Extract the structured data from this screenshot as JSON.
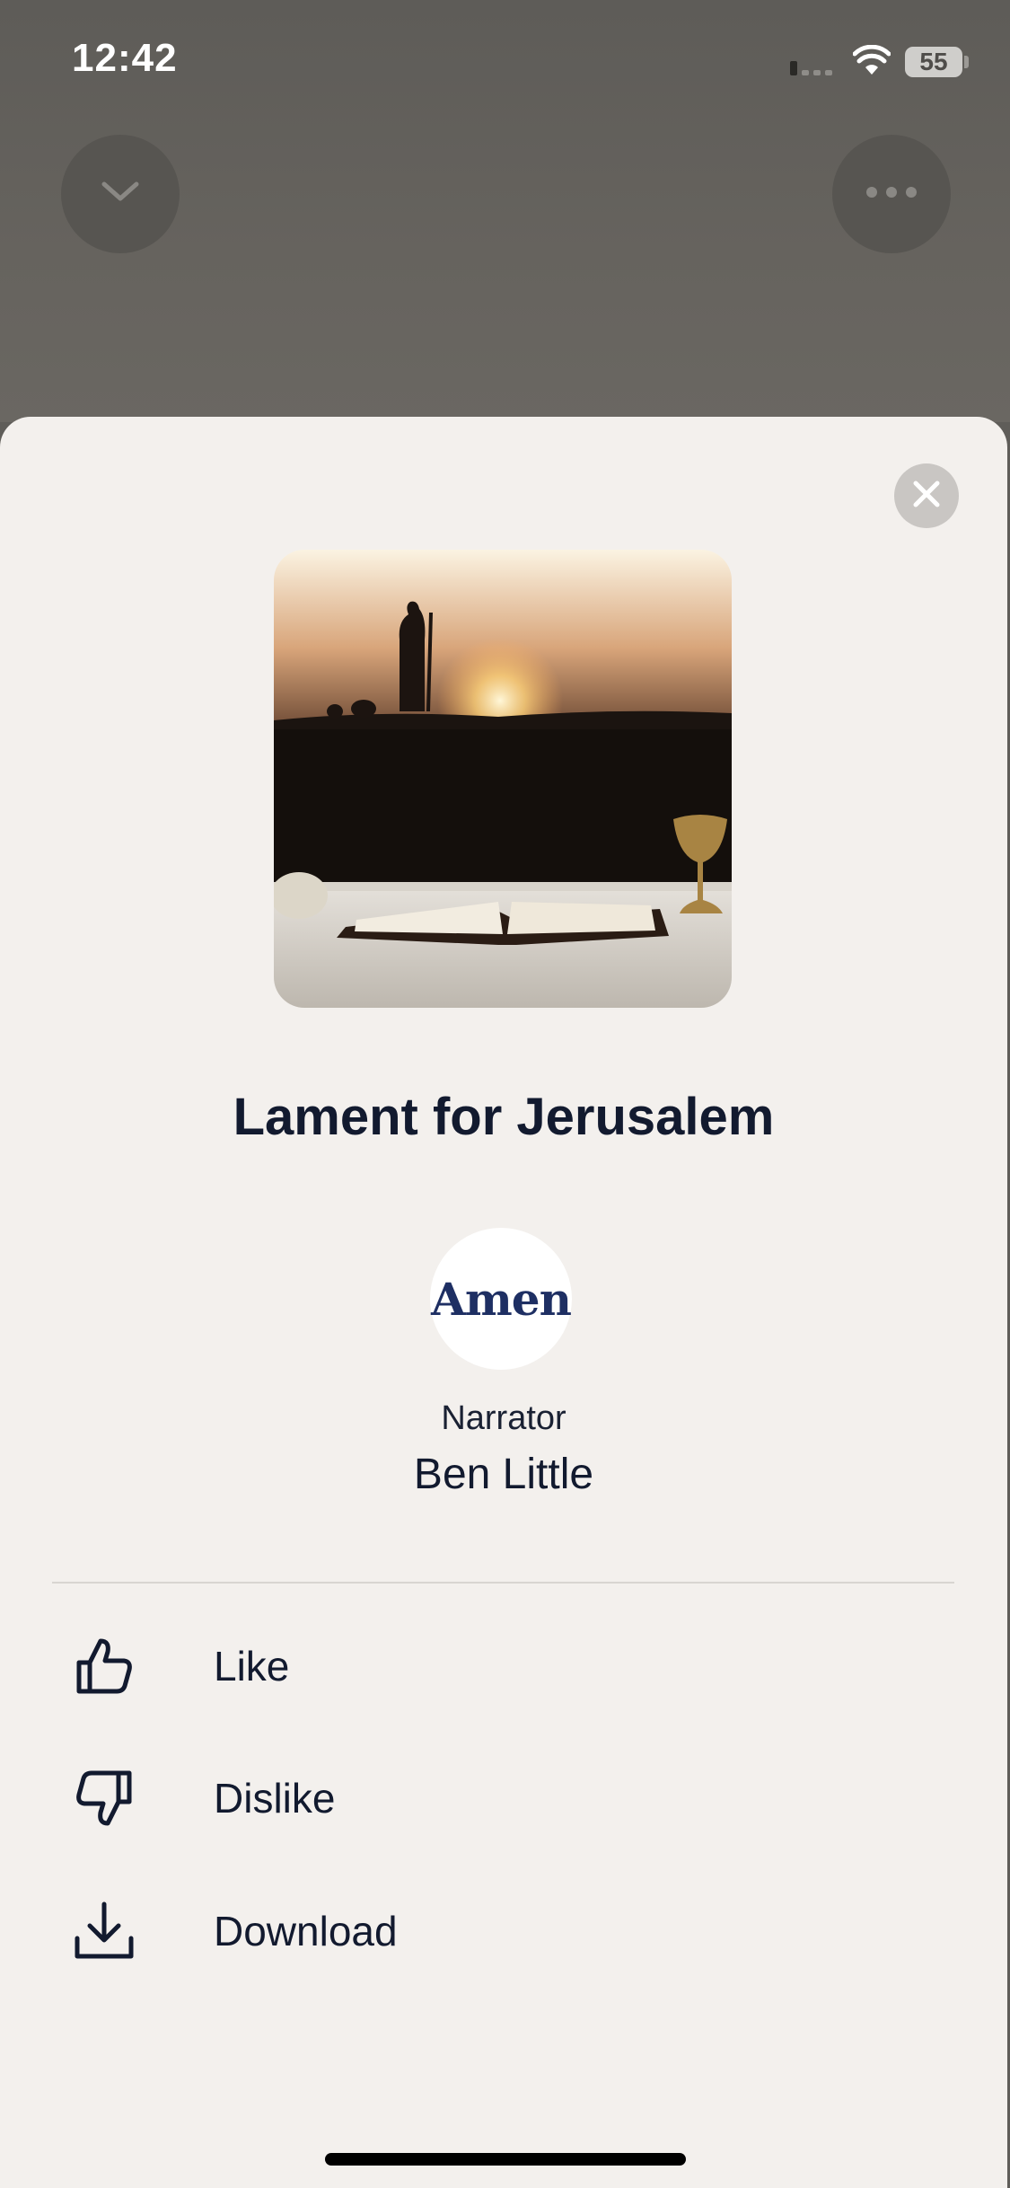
{
  "status_bar": {
    "time": "12:42",
    "battery": "55"
  },
  "player": {
    "collapse_icon": "chevron-down-icon",
    "more_icon": "more-horizontal-icon"
  },
  "sheet": {
    "close_icon": "close-icon",
    "title": "Lament for Jerusalem",
    "publisher_logo_text": "Amen",
    "narrator_label": "Narrator",
    "narrator_name": "Ben Little",
    "actions": [
      {
        "label": "Like",
        "icon": "thumbs-up-icon"
      },
      {
        "label": "Dislike",
        "icon": "thumbs-down-icon"
      },
      {
        "label": "Download",
        "icon": "download-icon"
      }
    ]
  },
  "colors": {
    "sheet_background": "#f3f0ed",
    "text_primary": "#121a2f",
    "logo_blue": "#1e2f63"
  }
}
